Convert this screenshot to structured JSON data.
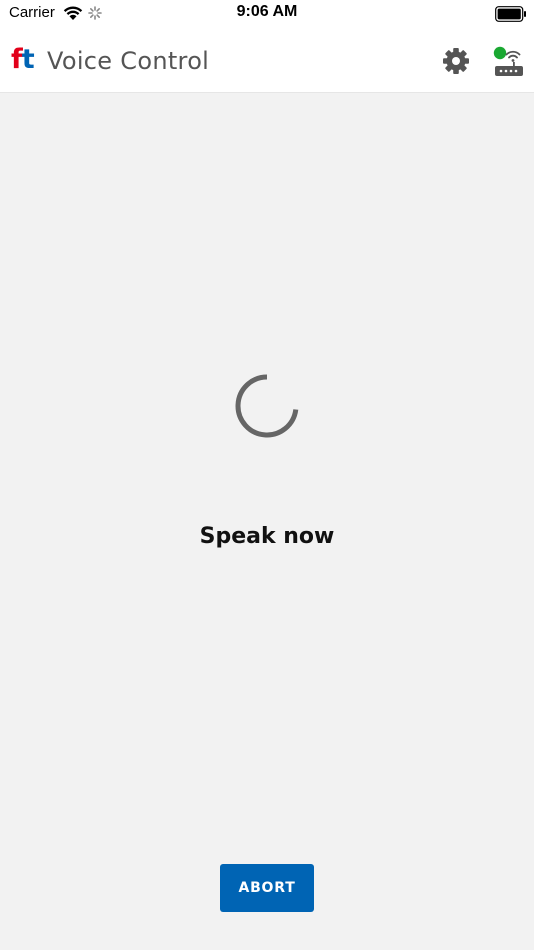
{
  "status_bar": {
    "carrier": "Carrier",
    "time": "9:06 AM"
  },
  "header": {
    "logo": {
      "f": "f",
      "t": "t"
    },
    "title": "Voice Control",
    "icons": [
      "gear-icon",
      "controller-icon"
    ],
    "connection_status_color": "#1aa832"
  },
  "main": {
    "prompt": "Speak now",
    "abort_label": "ABORT"
  },
  "colors": {
    "accent": "#0064b4",
    "logo_red": "#e2001a",
    "background": "#f2f2f2"
  }
}
